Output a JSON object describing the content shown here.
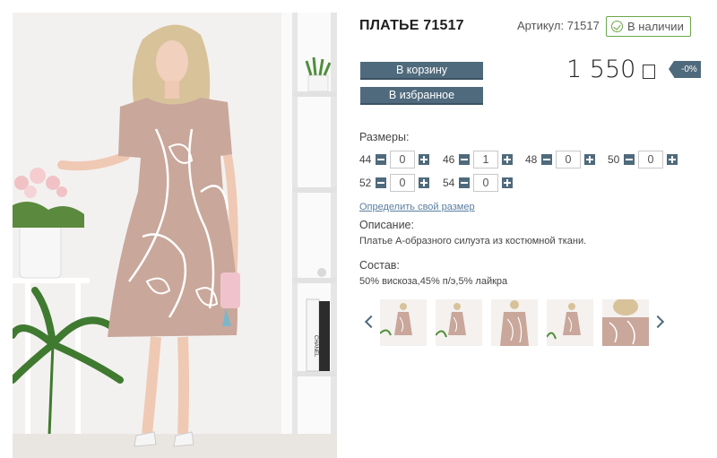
{
  "product": {
    "title": "ПЛАТЬЕ 71517",
    "sku_label": "Артикул: 71517",
    "stock_label": "В наличии",
    "price": "1 550",
    "discount": "-0%"
  },
  "buttons": {
    "cart": "В корзину",
    "favorites": "В избранное"
  },
  "sizes": {
    "label": "Размеры:",
    "items": [
      {
        "size": "44",
        "qty": "0"
      },
      {
        "size": "46",
        "qty": "1"
      },
      {
        "size": "48",
        "qty": "0"
      },
      {
        "size": "50",
        "qty": "0"
      },
      {
        "size": "52",
        "qty": "0"
      },
      {
        "size": "54",
        "qty": "0"
      }
    ],
    "find_size_link": "Определить свой размер"
  },
  "description": {
    "label": "Описание:",
    "text": "Платье А-образного силуэта из костюмной ткани."
  },
  "composition": {
    "label": "Состав:",
    "text": "50% вискоза,45% п/э,5% лайкра"
  },
  "gallery": {
    "thumbnail_count": 5,
    "nav_icons": [
      "chevron-left-icon",
      "chevron-right-icon"
    ]
  },
  "colors": {
    "accent": "#4f6a7c",
    "stock_green": "#6ba649",
    "link": "#5a7ea0",
    "dress": "#c9a79b"
  },
  "photo_text": {
    "book_spine": "CHANEL"
  }
}
